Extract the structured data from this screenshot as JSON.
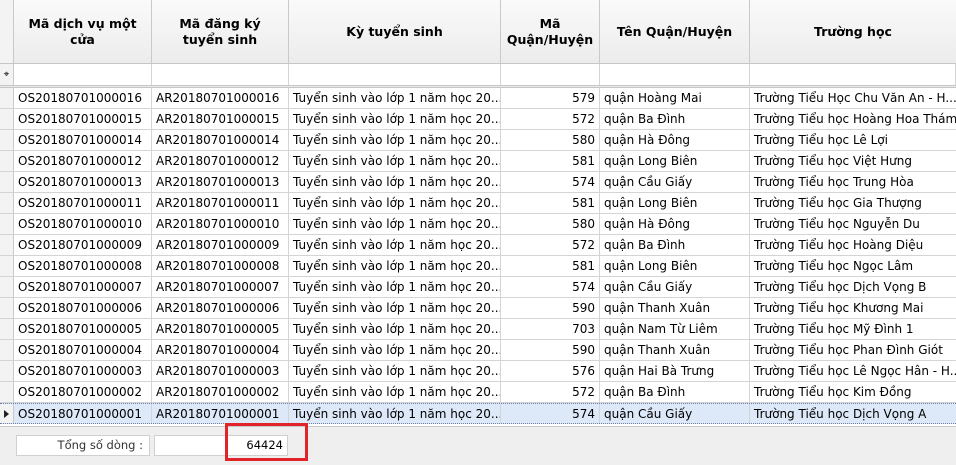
{
  "columns": [
    "Mã dịch vụ một cửa",
    "Mã đăng ký tuyển sinh",
    "Kỳ tuyển sinh",
    "Mã Quận/Huyện",
    "Tên Quận/Huyện",
    "Trường học"
  ],
  "filter_icon": "filter-pin-icon",
  "rows": [
    [
      "OS20180701000016",
      "AR20180701000016",
      "Tuyển sinh vào lớp 1 năm học 20...",
      "579",
      "quận Hoàng Mai",
      "Trường Tiểu Học Chu Văn An - H..."
    ],
    [
      "OS20180701000015",
      "AR20180701000015",
      "Tuyển sinh vào lớp 1 năm học 20...",
      "572",
      "quận Ba Đình",
      "Trường Tiểu học Hoàng Hoa Thám"
    ],
    [
      "OS20180701000014",
      "AR20180701000014",
      "Tuyển sinh vào lớp 1 năm học 20...",
      "580",
      "quận Hà Đông",
      "Trường Tiểu học Lê Lợi"
    ],
    [
      "OS20180701000012",
      "AR20180701000012",
      "Tuyển sinh vào lớp 1 năm học 20...",
      "581",
      "quận Long Biên",
      "Trường Tiểu học Việt Hưng"
    ],
    [
      "OS20180701000013",
      "AR20180701000013",
      "Tuyển sinh vào lớp 1 năm học 20...",
      "574",
      "quận Cầu Giấy",
      "Trường Tiểu học Trung Hòa"
    ],
    [
      "OS20180701000011",
      "AR20180701000011",
      "Tuyển sinh vào lớp 1 năm học 20...",
      "581",
      "quận Long Biên",
      "Trường Tiểu học Gia Thượng"
    ],
    [
      "OS20180701000010",
      "AR20180701000010",
      "Tuyển sinh vào lớp 1 năm học 20...",
      "580",
      "quận Hà Đông",
      "Trường Tiểu học Nguyễn Du"
    ],
    [
      "OS20180701000009",
      "AR20180701000009",
      "Tuyển sinh vào lớp 1 năm học 20...",
      "572",
      "quận Ba Đình",
      "Trường Tiểu học Hoàng Diệu"
    ],
    [
      "OS20180701000008",
      "AR20180701000008",
      "Tuyển sinh vào lớp 1 năm học 20...",
      "581",
      "quận Long Biên",
      "Trường Tiểu học Ngọc Lâm"
    ],
    [
      "OS20180701000007",
      "AR20180701000007",
      "Tuyển sinh vào lớp 1 năm học 20...",
      "574",
      "quận Cầu Giấy",
      "Trường Tiểu học Dịch Vọng B"
    ],
    [
      "OS20180701000006",
      "AR20180701000006",
      "Tuyển sinh vào lớp 1 năm học 20...",
      "590",
      "quận Thanh Xuân",
      "Trường Tiểu học Khương Mai"
    ],
    [
      "OS20180701000005",
      "AR20180701000005",
      "Tuyển sinh vào lớp 1 năm học 20...",
      "703",
      "quận Nam Từ Liêm",
      "Trường Tiểu học Mỹ Đình 1"
    ],
    [
      "OS20180701000004",
      "AR20180701000004",
      "Tuyển sinh vào lớp 1 năm học 20...",
      "590",
      "quận Thanh Xuân",
      "Trường Tiểu học Phan Đình Giót"
    ],
    [
      "OS20180701000003",
      "AR20180701000003",
      "Tuyển sinh vào lớp 1 năm học 20...",
      "576",
      "quận Hai Bà Trưng",
      "Trường Tiểu học Lê Ngọc Hân - H..."
    ],
    [
      "OS20180701000002",
      "AR20180701000002",
      "Tuyển sinh vào lớp 1 năm học 20...",
      "572",
      "quận Ba Đình",
      "Trường Tiểu học Kim Đồng"
    ],
    [
      "OS20180701000001",
      "AR20180701000001",
      "Tuyển sinh vào lớp 1 năm học 20...",
      "574",
      "quận Cầu Giấy",
      "Trường Tiểu học Dịch Vọng A"
    ]
  ],
  "selected_row": 15,
  "footer": {
    "total_label": "Tổng số dòng :",
    "total_value": "64424"
  },
  "colors": {
    "highlight": "#e0242a",
    "selected_row": "#dde8f8"
  }
}
